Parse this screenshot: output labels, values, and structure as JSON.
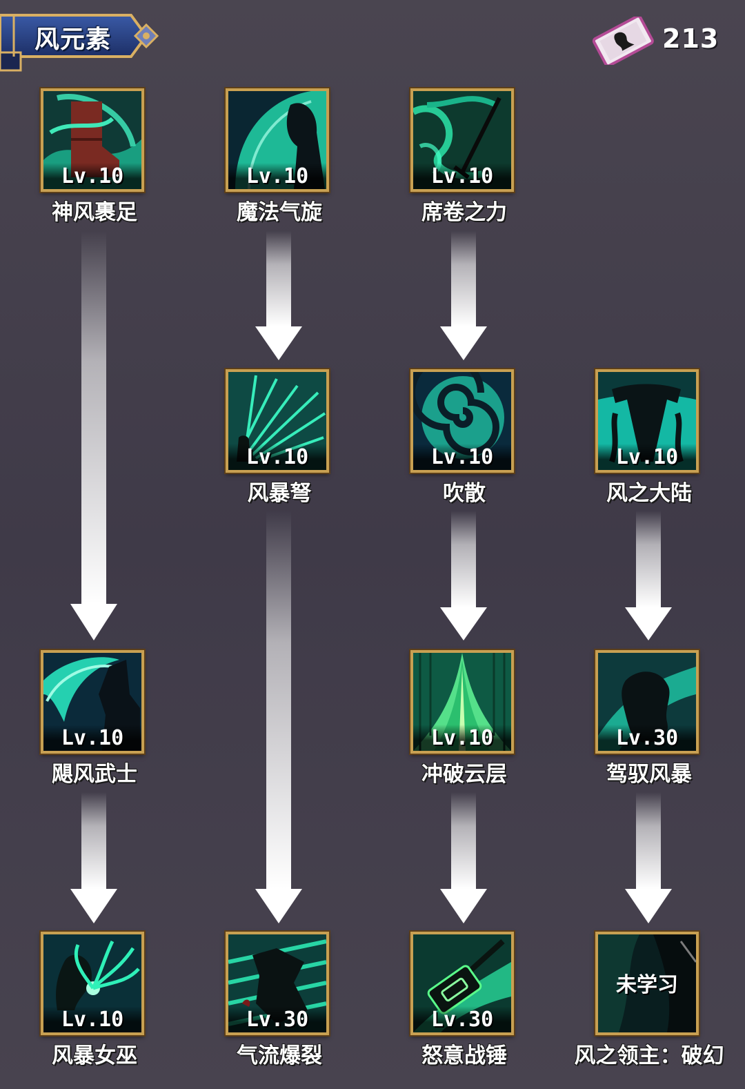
{
  "header": {
    "title": "风元素",
    "currency": {
      "icon": "scroll-card-icon",
      "value": "213"
    }
  },
  "colors": {
    "frame_gold": "#c8a052",
    "skill_teal": "#22d3a8",
    "background": "#433e4b"
  },
  "skills": [
    {
      "id": "s1",
      "name": "神风裹足",
      "level": "Lv.10",
      "icon": "wind-boot-icon"
    },
    {
      "id": "s2",
      "name": "魔法气旋",
      "level": "Lv.10",
      "icon": "magic-cyclone-icon"
    },
    {
      "id": "s3",
      "name": "席卷之力",
      "level": "Lv.10",
      "icon": "sweeping-force-icon"
    },
    {
      "id": "s4",
      "name": "风暴弩",
      "level": "Lv.10",
      "icon": "storm-crossbow-icon"
    },
    {
      "id": "s5",
      "name": "吹散",
      "level": "Lv.10",
      "icon": "spiral-wind-icon"
    },
    {
      "id": "s6",
      "name": "风之大陆",
      "level": "Lv.10",
      "icon": "wind-continent-icon"
    },
    {
      "id": "s7",
      "name": "飓风武士",
      "level": "Lv.10",
      "icon": "hurricane-warrior-icon"
    },
    {
      "id": "s8",
      "name": "冲破云层",
      "level": "Lv.10",
      "icon": "break-clouds-icon"
    },
    {
      "id": "s9",
      "name": "驾驭风暴",
      "level": "Lv.30",
      "icon": "ride-storm-icon"
    },
    {
      "id": "s10",
      "name": "风暴女巫",
      "level": "Lv.10",
      "icon": "storm-witch-icon"
    },
    {
      "id": "s11",
      "name": "气流爆裂",
      "level": "Lv.30",
      "icon": "airflow-burst-icon"
    },
    {
      "id": "s12",
      "name": "怒意战锤",
      "level": "Lv.30",
      "icon": "rage-hammer-icon"
    },
    {
      "id": "s13",
      "name": "风之领主：破幻",
      "level": "",
      "status": "未学习",
      "icon": "wind-lord-icon"
    }
  ]
}
